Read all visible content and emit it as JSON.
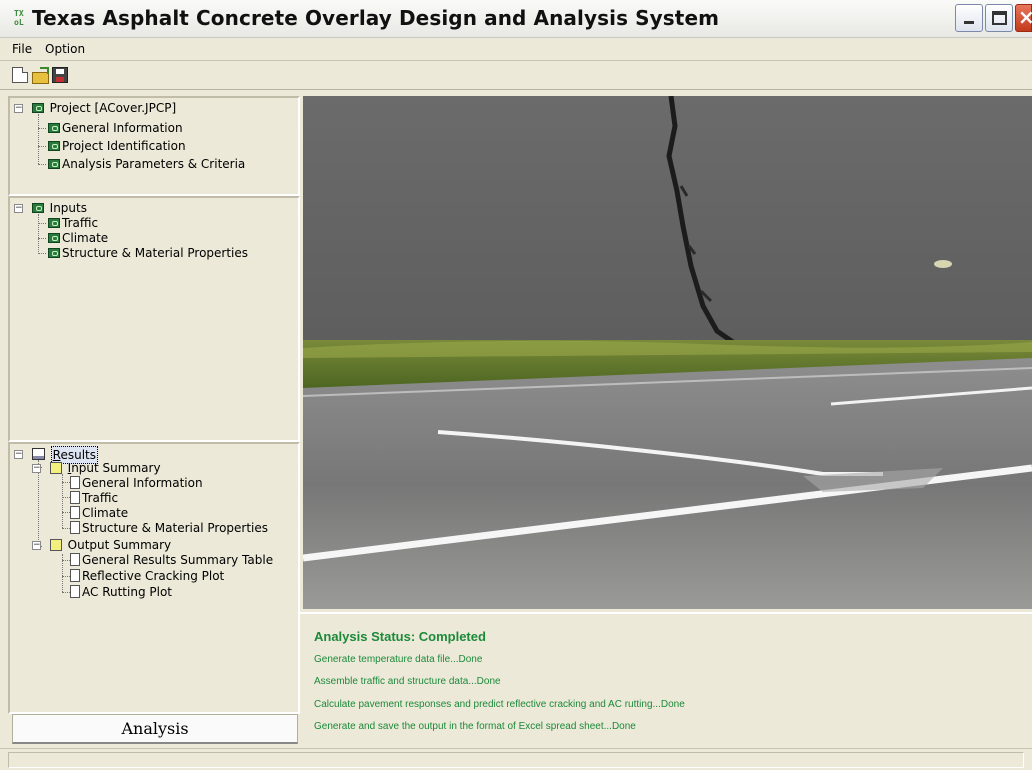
{
  "window": {
    "title": "Texas Asphalt Concrete Overlay Design and Analysis System",
    "icon": "app-logo-icon"
  },
  "menu": [
    "File",
    "Option"
  ],
  "toolbar": {
    "buttons": [
      "new-file-icon",
      "open-folder-icon",
      "save-disk-icon"
    ]
  },
  "tree": {
    "project": {
      "label": "Project [ACover.JPCP]",
      "children": [
        "General Information",
        "Project Identification",
        "Analysis Parameters & Criteria"
      ]
    },
    "inputs": {
      "label": "Inputs",
      "children": [
        "Traffic",
        "Climate",
        "Structure & Material Properties"
      ]
    },
    "results": {
      "label": "Results",
      "input_summary": {
        "label": "Input Summary",
        "children": [
          "General Information",
          "Traffic",
          "Climate",
          "Structure & Material Properties"
        ]
      },
      "output_summary": {
        "label": "Output Summary",
        "children": [
          "General Results Summary Table",
          "Reflective Cracking Plot",
          "AC Rutting Plot"
        ]
      }
    }
  },
  "analysis_button": "Analysis",
  "status": {
    "title": "Analysis Status: Completed",
    "lines": [
      "Generate temperature data file...Done",
      "Assemble traffic and structure data...Done",
      "Calculate pavement responses and predict reflective cracking and AC rutting...Done",
      "Generate and save the output in the format of Excel spread sheet...Done"
    ]
  },
  "colors": {
    "status_text": "#1c8a3a",
    "window_bg": "#ece9d8"
  }
}
